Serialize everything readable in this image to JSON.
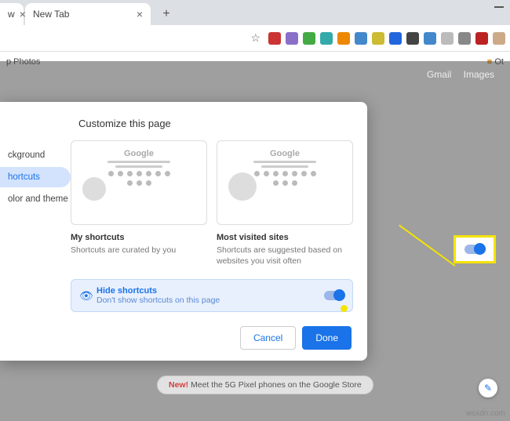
{
  "tabs": {
    "partial_close": "×",
    "new_tab": "New Tab",
    "new_tab_close": "×",
    "add": "+"
  },
  "bookmarks": {
    "item1": "p Photos",
    "other": "Ot"
  },
  "overlay_links": {
    "gmail": "Gmail",
    "images": "Images"
  },
  "dialog": {
    "title": "Customize this page",
    "side": {
      "background": "ckground",
      "shortcuts": "hortcuts",
      "color": "olor and theme"
    },
    "google": "Google",
    "card1": {
      "title": "My shortcuts",
      "desc": "Shortcuts are curated by you"
    },
    "card2": {
      "title": "Most visited sites",
      "desc": "Shortcuts are suggested based on websites you visit often"
    },
    "hide": {
      "title": "Hide shortcuts",
      "sub": "Don't show shortcuts on this page"
    },
    "cancel": "Cancel",
    "done": "Done"
  },
  "promo": {
    "new": "New!",
    "text": " Meet the 5G Pixel phones on the Google Store"
  },
  "watermark": "wsxdn.com"
}
